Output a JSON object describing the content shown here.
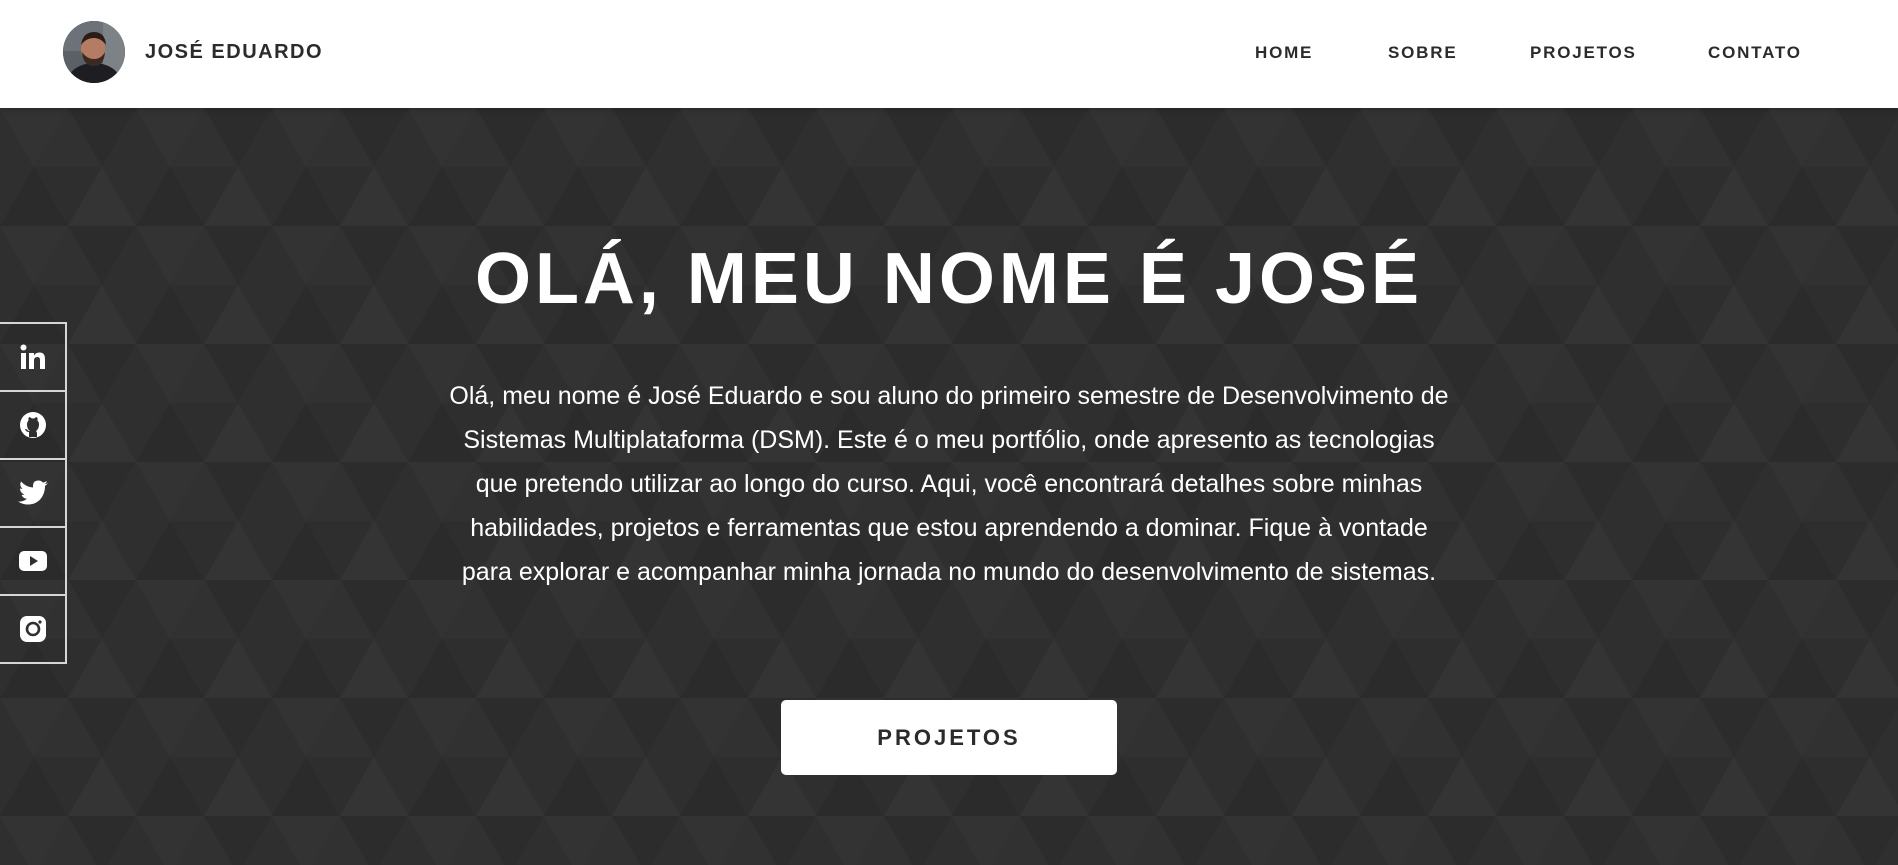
{
  "header": {
    "brand_name": "JOSÉ EDUARDO",
    "avatar_icon": "profile-photo",
    "nav": [
      {
        "label": "HOME"
      },
      {
        "label": "SOBRE"
      },
      {
        "label": "PROJETOS"
      },
      {
        "label": "CONTATO"
      }
    ]
  },
  "hero": {
    "title": "OLÁ, MEU NOME É JOSÉ",
    "paragraph": "Olá, meu nome é José Eduardo e sou aluno do primeiro semestre de Desenvolvimento de Sistemas Multiplataforma (DSM). Este é o meu portfólio, onde apresento as tecnologias que pretendo utilizar ao longo do curso. Aqui, você encontrará detalhes sobre minhas habilidades, projetos e ferramentas que estou aprendendo a dominar. Fique à vontade para explorar e acompanhar minha jornada no mundo do desenvolvimento de sistemas.",
    "cta_label": "PROJETOS"
  },
  "social": [
    {
      "icon": "linkedin-icon"
    },
    {
      "icon": "github-icon"
    },
    {
      "icon": "twitter-icon"
    },
    {
      "icon": "youtube-icon"
    },
    {
      "icon": "instagram-icon"
    }
  ],
  "colors": {
    "header_bg": "#ffffff",
    "hero_bg": "#2f2f2f",
    "text_dark": "#2b2b2b",
    "text_light": "#ffffff"
  }
}
